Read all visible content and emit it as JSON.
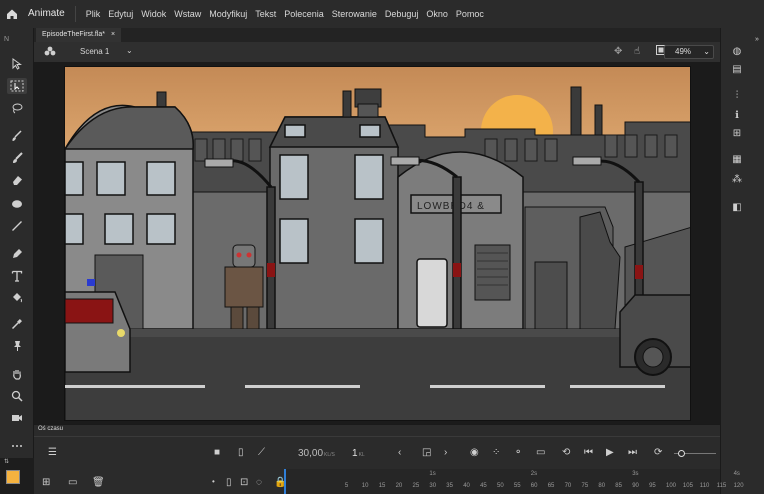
{
  "app": {
    "name": "Animate"
  },
  "menu": [
    "Plik",
    "Edytuj",
    "Widok",
    "Wstaw",
    "Modyfikuj",
    "Tekst",
    "Polecenia",
    "Sterowanie",
    "Debuguj",
    "Okno",
    "Pomoc"
  ],
  "document": {
    "tab_title": "EpisodeTheFirst.fla*",
    "close_glyph": "×"
  },
  "scene": {
    "name": "Scena 1"
  },
  "zoom": {
    "value": "49%"
  },
  "stage": {
    "sign_text": "LOWBRD4 &"
  },
  "timeline": {
    "title": "Oś czasu",
    "fps": "30,00",
    "fps_unit": "KL/S",
    "frame": "1",
    "frame_unit": "KL",
    "seconds_labels": [
      "1s",
      "2s",
      "3s",
      "4s"
    ],
    "frame_labels": [
      "5",
      "10",
      "15",
      "20",
      "25",
      "30",
      "35",
      "40",
      "45",
      "50",
      "55",
      "60",
      "65",
      "70",
      "75",
      "80",
      "85",
      "90",
      "95",
      "100",
      "105",
      "110",
      "115",
      "120"
    ]
  },
  "colors": {
    "sky": "#d9a064",
    "sun": "#f3b24a",
    "accent": "#2f7fd8",
    "fill_swatch": "#f4b23f"
  }
}
